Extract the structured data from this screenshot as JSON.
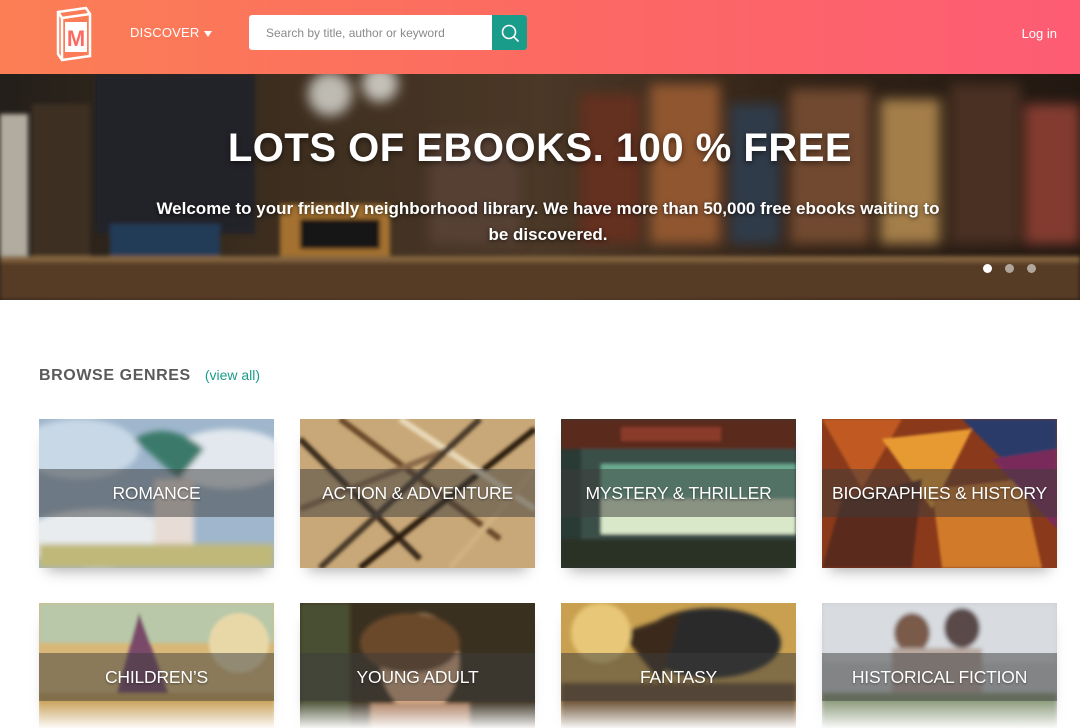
{
  "header": {
    "discover_label": "DISCOVER",
    "search_placeholder": "Search by title, author or keyword",
    "login_label": "Log in",
    "logo_letter": "M"
  },
  "hero": {
    "title": "LOTS OF EBOOKS. 100 % FREE",
    "subtitle": "Welcome to your friendly neighborhood library. We have more than 50,000 free ebooks waiting to be discovered.",
    "slide_count": 3,
    "active_slide": 1
  },
  "genres": {
    "title": "BROWSE GENRES",
    "view_all_label": "(view all)",
    "items": [
      {
        "label": "ROMANCE"
      },
      {
        "label": "ACTION & ADVENTURE"
      },
      {
        "label": "MYSTERY & THRILLER"
      },
      {
        "label": "BIOGRAPHIES & HISTORY"
      },
      {
        "label": "CHILDREN’S"
      },
      {
        "label": "YOUNG ADULT"
      },
      {
        "label": "FANTASY"
      },
      {
        "label": "HISTORICAL FICTION"
      }
    ]
  },
  "colors": {
    "header_gradient_start": "#fb7f55",
    "header_gradient_end": "#fd5c74",
    "accent_teal": "#1a9c8a"
  }
}
